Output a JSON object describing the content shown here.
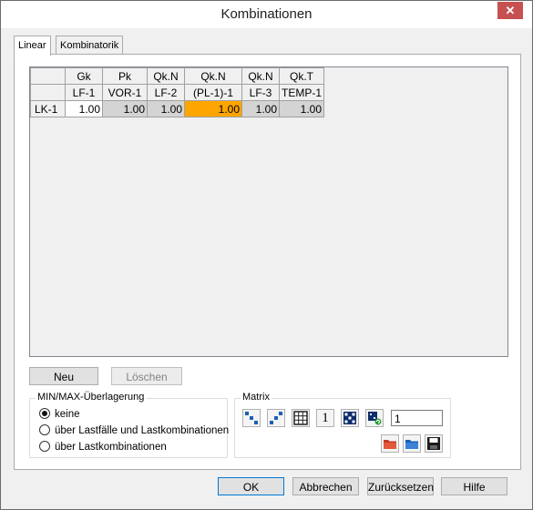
{
  "window": {
    "title": "Kombinationen",
    "close_label": "✕"
  },
  "tabs": [
    {
      "label": "Linear"
    },
    {
      "label": "Kombinatorik"
    }
  ],
  "grid": {
    "header_row1": [
      "Gk",
      "Pk",
      "Qk.N",
      "Qk.N",
      "Qk.N",
      "Qk.T"
    ],
    "header_row2": [
      "LF-1",
      "VOR-1",
      "LF-2",
      "(PL-1)-1",
      "LF-3",
      "TEMP-1"
    ],
    "rows": [
      {
        "label": "LK-1",
        "values": [
          "1.00",
          "1.00",
          "1.00",
          "1.00",
          "1.00",
          "1.00"
        ]
      }
    ]
  },
  "buttons": {
    "neu": "Neu",
    "loeschen": "Löschen"
  },
  "minmax": {
    "title": "MIN/MAX-Überlagerung",
    "options": [
      "keine",
      "über Lastfälle und Lastkombinationen",
      "über Lastkombinationen"
    ],
    "selected": "keine"
  },
  "matrix": {
    "title": "Matrix",
    "value": "1",
    "one_label": "1"
  },
  "footer": {
    "ok": "OK",
    "cancel": "Abbrechen",
    "reset": "Zurücksetzen",
    "help": "Hilfe"
  },
  "colors": {
    "highlight": "#ffa500",
    "primary_border": "#0078d7"
  }
}
